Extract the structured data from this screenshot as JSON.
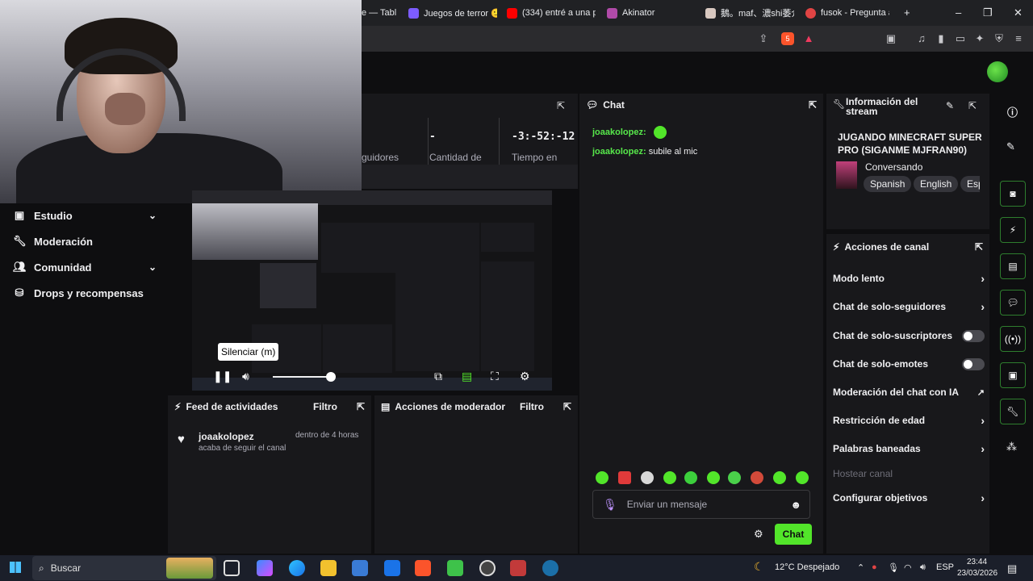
{
  "browser": {
    "tabs": [
      {
        "label": "e — Tabl"
      },
      {
        "label": "Juegos de terror 🙂"
      },
      {
        "label": "(334) entré a una p"
      },
      {
        "label": "Akinator"
      },
      {
        "label": "鵝。maf、濃shi萎介"
      },
      {
        "label": "fusok - Pregunta a"
      }
    ],
    "new_tab": "+",
    "badge_count": "5"
  },
  "tooltip": "Silenciar (m)",
  "stats": {
    "followers_label": "guidores",
    "count_value": "-",
    "count_label": "Cantidad de",
    "time_value": "-3:-52:-12",
    "time_label": "Tiempo en"
  },
  "leftnav": {
    "items": [
      {
        "label": "Estudio",
        "icon": "camera-icon",
        "chevron": "⌄"
      },
      {
        "label": "Moderación",
        "icon": "wrench-icon"
      },
      {
        "label": "Comunidad",
        "icon": "people-icon",
        "chevron": "⌄"
      },
      {
        "label": "Drops y recompensas",
        "icon": "gift-icon"
      }
    ]
  },
  "feed": {
    "title": "Feed de actividades",
    "filter": "Filtro",
    "item_user": "joaakolopez",
    "item_time": "dentro de 4 horas",
    "item_text": "acaba de seguir el canal"
  },
  "mod_actions": {
    "title": "Acciones de moderador",
    "filter": "Filtro"
  },
  "chat": {
    "title": "Chat",
    "messages": [
      {
        "user": "joaakolopez:",
        "text": ""
      },
      {
        "user": "joaakolopez:",
        "text": "subile al mic"
      }
    ],
    "placeholder": "Enviar un mensaje",
    "send_label": "Chat"
  },
  "stream_info": {
    "title": "Información del stream",
    "stream_title": "JUGANDO MINECRAFT SUPER PRO (SIGANME MJFRAN90)",
    "category": "Conversando",
    "tags": [
      "Spanish",
      "English",
      "Esp"
    ]
  },
  "channel_actions": {
    "title": "Acciones de canal",
    "items": [
      {
        "label": "Modo lento",
        "control": "chevron"
      },
      {
        "label": "Chat de solo-seguidores",
        "control": "chevron"
      },
      {
        "label": "Chat de solo-suscriptores",
        "control": "toggle"
      },
      {
        "label": "Chat de solo-emotes",
        "control": "toggle"
      },
      {
        "label": "Moderación del chat con IA",
        "control": "external"
      },
      {
        "label": "Restricción de edad",
        "control": "chevron"
      },
      {
        "label": "Palabras baneadas",
        "control": "chevron"
      },
      {
        "label": "Hostear canal",
        "control": "none"
      },
      {
        "label": "Configurar objetivos",
        "control": "chevron"
      }
    ]
  },
  "taskbar": {
    "search": "Buscar",
    "weather": "12°C Despejado",
    "lang": "ESP",
    "time": "23:44",
    "date": "23/03/2026"
  },
  "colors": {
    "accent": "#52e52a",
    "panel": "#18181b",
    "background": "#0e0e10"
  }
}
